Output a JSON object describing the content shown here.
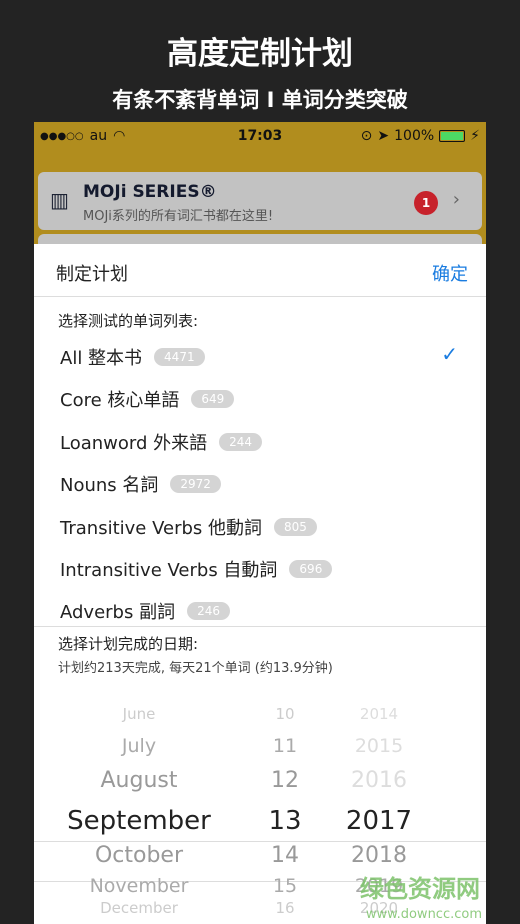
{
  "promo": {
    "title": "高度定制计划",
    "subtitle": "有条不紊背单词 I 单词分类突破"
  },
  "status_bar": {
    "signal": "●●●○○",
    "carrier": "au",
    "time": "17:03",
    "battery": "100%",
    "battery_level": 1.0
  },
  "banner": {
    "title": "MOJi SERIES®",
    "subtitle": "MOJi系列的所有词汇书都在这里!",
    "badge": "1"
  },
  "sheet": {
    "title": "制定计划",
    "confirm": "确定",
    "list_label": "选择测试的单词列表:",
    "items": [
      {
        "label": "All 整本书",
        "count": "4471",
        "checked": true
      },
      {
        "label": "Core 核心单語",
        "count": "649"
      },
      {
        "label": "Loanword 外来語",
        "count": "244"
      },
      {
        "label": "Nouns 名詞",
        "count": "2972"
      },
      {
        "label": "Transitive Verbs 他動詞",
        "count": "805"
      },
      {
        "label": "Intransitive Verbs 自動詞",
        "count": "696"
      },
      {
        "label": "Adverbs 副詞",
        "count": "246"
      }
    ],
    "date_label": "选择计划完成的日期:",
    "date_hint": "计划约213天完成, 每天21个单词 (约13.9分钟)"
  },
  "picker": {
    "months": [
      "June",
      "July",
      "August",
      "September",
      "October",
      "November",
      "December"
    ],
    "days": [
      "10",
      "11",
      "12",
      "13",
      "14",
      "15",
      "16"
    ],
    "years": [
      "2014",
      "2015",
      "2016",
      "2017",
      "2018",
      "2019",
      "2020"
    ],
    "selected_index": 3
  },
  "watermark": {
    "text": "绿色资源网",
    "url": "www.downcc.com"
  },
  "colors": {
    "accent": "#1a7ce0",
    "header": "#b18d1e",
    "badge": "#c7222b"
  }
}
